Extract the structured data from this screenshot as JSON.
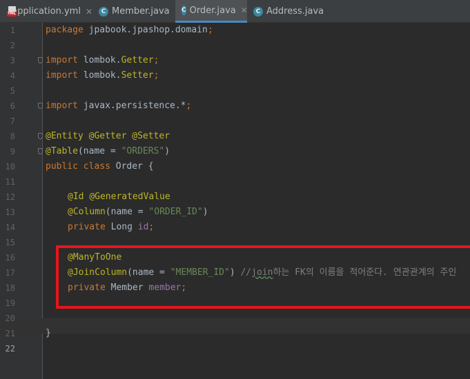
{
  "tabs": [
    {
      "label": "application.yml",
      "icon": "yml-file-icon",
      "active": false
    },
    {
      "label": "Member.java",
      "icon": "class-icon",
      "active": false
    },
    {
      "label": "Order.java",
      "icon": "class-icon",
      "active": true
    },
    {
      "label": "Address.java",
      "icon": "class-icon",
      "active": false
    }
  ],
  "icons": {
    "class_letter": "C",
    "yml_label": "YML",
    "close_glyph": "✕"
  },
  "line_numbers": [
    "1",
    "2",
    "3",
    "4",
    "5",
    "6",
    "7",
    "8",
    "9",
    "10",
    "11",
    "12",
    "13",
    "14",
    "15",
    "16",
    "17",
    "18",
    "19",
    "20",
    "21",
    "22"
  ],
  "code": {
    "l1": {
      "kw": "package",
      "rest": " jpabook.jpashop.domain",
      "semi": ";"
    },
    "l3": {
      "kw": "import",
      "pkg": " lombok.",
      "cls": "Getter",
      "semi": ";"
    },
    "l4": {
      "kw": "import",
      "pkg": " lombok.",
      "cls": "Setter",
      "semi": ";"
    },
    "l6": {
      "kw": "import",
      "rest": " javax.persistence.*",
      "semi": ";"
    },
    "l8": {
      "a1": "@Entity",
      "a2": "@Getter",
      "a3": "@Setter"
    },
    "l9": {
      "ann": "@Table",
      "p1": "(name = ",
      "str": "\"ORDERS\"",
      "p2": ")"
    },
    "l10": {
      "kw": "public class",
      "rest": " Order {"
    },
    "l12": {
      "a1": "@Id",
      "a2": "@GeneratedValue"
    },
    "l13": {
      "ann": "@Column",
      "p1": "(name = ",
      "str": "\"ORDER_ID\"",
      "p2": ")"
    },
    "l14": {
      "kw": "private",
      "type": " Long ",
      "field": "id",
      "semi": ";"
    },
    "l16": {
      "ann": "@ManyToOne"
    },
    "l17": {
      "ann": "@JoinColumn",
      "p1": "(name = ",
      "str": "\"MEMBER_ID\"",
      "p2": ") ",
      "c1": "//",
      "c2": "join",
      "c3": "하는 FK의 이름을 적어준다. 연관관계의 주인"
    },
    "l18": {
      "kw": "private",
      "type": " Member ",
      "field": "member",
      "semi": ";"
    },
    "l21": {
      "brace": "}"
    }
  },
  "colors": {
    "keyword": "#cc7832",
    "annotation": "#bbb529",
    "string": "#6a8759",
    "field": "#9876aa",
    "comment": "#808080",
    "highlight_box": "#e8151b"
  }
}
